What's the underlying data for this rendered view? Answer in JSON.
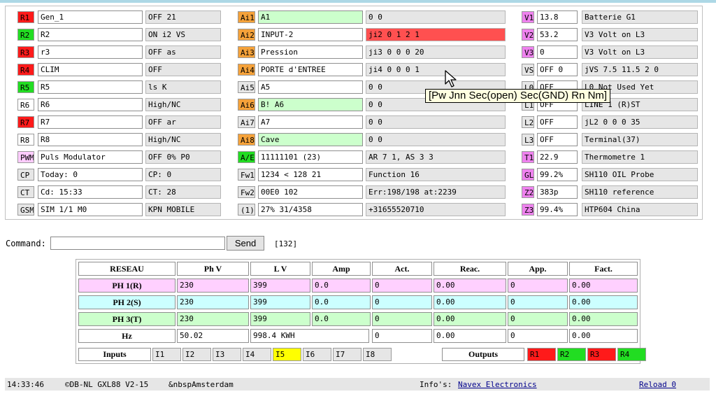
{
  "theme": {
    "red": "#ff1a1a",
    "green": "#22dd22",
    "orange": "#f5a23a",
    "magenta": "#ee82ee",
    "pink": "#ffccff",
    "cyan": "#ccffff",
    "lightgreen": "#ccffcc",
    "lightpink": "#ffd0ff",
    "yellow": "#ffff00",
    "ai_red": "#ff5050",
    "ai_green": "#ccffcc"
  },
  "relays": [
    {
      "tag": "R1",
      "tag_color": "red",
      "name": "Gen_1",
      "state": "OFF 21"
    },
    {
      "tag": "R2",
      "tag_color": "green",
      "name": "R2",
      "state": "ON i2 VS"
    },
    {
      "tag": "R3",
      "tag_color": "red",
      "name": "r3",
      "state": "OFF as"
    },
    {
      "tag": "R4",
      "tag_color": "red",
      "name": "CLIM",
      "state": "OFF"
    },
    {
      "tag": "R5",
      "tag_color": "green",
      "name": "R5",
      "state": "ls K"
    },
    {
      "tag": "R6",
      "tag_color": "none",
      "name": "R6",
      "state": "High/NC"
    },
    {
      "tag": "R7",
      "tag_color": "red",
      "name": "R7",
      "state": "OFF ar"
    },
    {
      "tag": "R8",
      "tag_color": "none",
      "name": "R8",
      "state": "High/NC"
    },
    {
      "tag": "PWM",
      "tag_color": "pink",
      "name": "Puls Modulator",
      "state": "OFF 0% P0"
    },
    {
      "tag": "CP",
      "tag_color": "grey",
      "name": "Today: 0",
      "state": "CP: 0"
    },
    {
      "tag": "CT",
      "tag_color": "grey",
      "name": "Cd: 15:33",
      "state": "CT: 28"
    },
    {
      "tag": "GSM",
      "tag_color": "grey",
      "name": "SIM 1/1 M0",
      "state": "KPN MOBILE"
    }
  ],
  "analog": [
    {
      "tag": "Ai1",
      "tag_color": "orange",
      "name": "A1",
      "name_bg": "ai_green",
      "value": "0 0",
      "value_bg": "grey"
    },
    {
      "tag": "Ai2",
      "tag_color": "orange",
      "name": "INPUT-2",
      "name_bg": "white",
      "value": "ji2 0 1 2 1",
      "value_bg": "ai_red"
    },
    {
      "tag": "Ai3",
      "tag_color": "orange",
      "name": "Pression",
      "name_bg": "white",
      "value": "ji3 0 0 0 20",
      "value_bg": "grey"
    },
    {
      "tag": "Ai4",
      "tag_color": "orange",
      "name": "PORTE d'ENTREE",
      "name_bg": "white",
      "value": "ji4 0 0 0 1",
      "value_bg": "grey"
    },
    {
      "tag": "Ai5",
      "tag_color": "grey",
      "name": "A5",
      "name_bg": "white",
      "value": "0 0",
      "value_bg": "grey"
    },
    {
      "tag": "Ai6",
      "tag_color": "orange",
      "name": "B! A6",
      "name_bg": "ai_green",
      "value": "0 0",
      "value_bg": "grey"
    },
    {
      "tag": "Ai7",
      "tag_color": "grey",
      "name": "A7",
      "name_bg": "white",
      "value": "0 0",
      "value_bg": "grey"
    },
    {
      "tag": "Ai8",
      "tag_color": "orange",
      "name": "Cave",
      "name_bg": "ai_green",
      "value": "0 0",
      "value_bg": "grey"
    },
    {
      "tag": "A/E",
      "tag_color": "green",
      "name": "11111101 (23)",
      "name_bg": "white",
      "value": "AR 7 1, AS 3 3",
      "value_bg": "grey"
    },
    {
      "tag": "Fw1",
      "tag_color": "grey",
      "name": "1234 < 128 21",
      "name_bg": "white",
      "value": "Function 16",
      "value_bg": "grey"
    },
    {
      "tag": "Fw2",
      "tag_color": "grey",
      "name": "00E0 102",
      "name_bg": "white",
      "value": "Err:198/198 at:2239",
      "value_bg": "grey"
    },
    {
      "tag": "(1)",
      "tag_color": "grey",
      "name": "27% 31/4358",
      "name_bg": "white",
      "value": "+31655520710",
      "value_bg": "grey"
    }
  ],
  "voltages": [
    {
      "tag": "V1",
      "tag_color": "magenta",
      "value": "13.8",
      "label": "Batterie G1"
    },
    {
      "tag": "V2",
      "tag_color": "magenta",
      "value": "53.2",
      "label": "V3 Volt on L3"
    },
    {
      "tag": "V3",
      "tag_color": "magenta",
      "value": "0",
      "label": "V3 Volt on L3"
    },
    {
      "tag": "VS",
      "tag_color": "grey",
      "value": "OFF 0",
      "label": "jVS 7.5 11.5 2 0"
    },
    {
      "tag": "L0",
      "tag_color": "grey",
      "value": "OFF",
      "label": "L0 Not Used Yet"
    },
    {
      "tag": "L1",
      "tag_color": "grey",
      "value": "OFF",
      "label": "LINE 1 (R)ST"
    },
    {
      "tag": "L2",
      "tag_color": "grey",
      "value": "OFF",
      "label": "jL2 0 0 0 35"
    },
    {
      "tag": "L3",
      "tag_color": "grey",
      "value": "OFF",
      "label": "Terminal(37)"
    },
    {
      "tag": "T1",
      "tag_color": "magenta",
      "value": "22.9",
      "label": "Thermometre 1"
    },
    {
      "tag": "GL",
      "tag_color": "magenta",
      "value": "99.2%",
      "label": "SH110 OIL Probe"
    },
    {
      "tag": "Z2",
      "tag_color": "magenta",
      "value": "383p",
      "label": "SH110 reference"
    },
    {
      "tag": "Z3",
      "tag_color": "magenta",
      "value": "99.4%",
      "label": "HTP604 China"
    }
  ],
  "tooltip": "[Pw Jnn Sec(open) Sec(GND) Rn Nm]",
  "command": {
    "label": "Command:",
    "value": "",
    "send": "Send",
    "count": "[132]"
  },
  "grid": {
    "headers": [
      "RESEAU",
      "Ph V",
      "L V",
      "Amp",
      "Act.",
      "Reac.",
      "App.",
      "Fact."
    ],
    "rows": [
      {
        "label": "PH 1(R)",
        "bg": "lightpink",
        "cells": [
          "230",
          "399",
          "0.0",
          "0",
          "0.00",
          "0",
          "0.00"
        ]
      },
      {
        "label": "PH 2(S)",
        "bg": "cyan",
        "cells": [
          "230",
          "399",
          "0.0",
          "0",
          "0.00",
          "0",
          "0.00"
        ]
      },
      {
        "label": "PH 3(T)",
        "bg": "lightgreen",
        "cells": [
          "230",
          "399",
          "0.0",
          "0",
          "0.00",
          "0",
          "0.00"
        ]
      }
    ],
    "hz": {
      "label": "Hz",
      "freq": "50.02",
      "energy": "998.4 KWH",
      "c4": "0",
      "c5": "0.00",
      "c6": "0",
      "c7": "0.00"
    }
  },
  "inputs": {
    "label": "Inputs",
    "items": [
      {
        "name": "I1",
        "color": "grey"
      },
      {
        "name": "I2",
        "color": "grey"
      },
      {
        "name": "I3",
        "color": "grey"
      },
      {
        "name": "I4",
        "color": "grey"
      },
      {
        "name": "I5",
        "color": "yellow"
      },
      {
        "name": "I6",
        "color": "grey"
      },
      {
        "name": "I7",
        "color": "grey"
      },
      {
        "name": "I8",
        "color": "grey"
      }
    ]
  },
  "outputs": {
    "label": "Outputs",
    "items": [
      {
        "name": "R1",
        "color": "red"
      },
      {
        "name": "R2",
        "color": "green"
      },
      {
        "name": "R3",
        "color": "red"
      },
      {
        "name": "R4",
        "color": "green"
      }
    ]
  },
  "footer": {
    "time": "14:33:46",
    "copyright": "©DB-NL GXL88 V2-15",
    "location": "&nbspAmsterdam",
    "info_label": "Info's:",
    "info_link": "Navex Electronics",
    "reload": "Reload 0"
  }
}
